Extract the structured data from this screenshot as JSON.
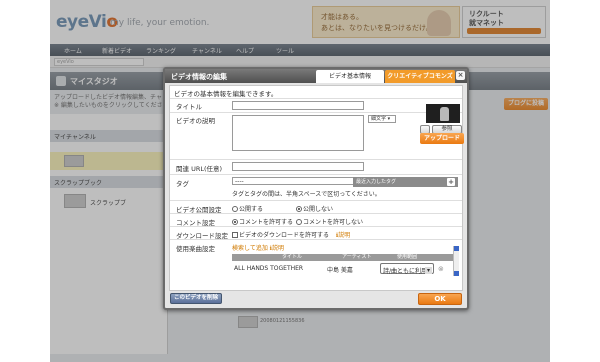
{
  "site": {
    "logo": "eyeVio",
    "logo_accent": "o",
    "tagline": "my life, your emotion.",
    "ad1_text": "才能はある。\nあとは、なりたいを見つけるだけ。",
    "ad2_text": "リクルート\n就マネット",
    "nav": [
      "ホーム",
      "新着ビデオ",
      "ランキング",
      "チャンネル",
      "ヘルプ",
      "ツール"
    ],
    "search_placeholder": "eyeVio",
    "studio_title": "マイスタジオ",
    "info_line": "アップロードしたビデオ情報編集、チャンネル作成",
    "info_line2": "※ 編集したいものをクリックしてください。",
    "left_headers": [
      "マイチャンネル",
      "スクラップブック"
    ],
    "left_item": "スクラップブ",
    "right_btn_1": "ブログに投稿",
    "bottom_code": "20080121155836",
    "colors": {
      "orange": "#ec7f18",
      "nav_dark": "#4b5560",
      "accent_blue": "#6b8fb2"
    }
  },
  "modal": {
    "title": "ビデオ情報の編集",
    "tabs": [
      "ビデオ基本情報",
      "クリエイティブコモンズ"
    ],
    "close": "×",
    "description": "ビデオの基本情報を編集できます。",
    "labels": {
      "title": "タイトル",
      "desc": "ビデオの説明",
      "url": "関連 URL(任意)",
      "tag": "タグ",
      "public": "ビデオ公開設定",
      "comment": "コメント設定",
      "download": "ダウンロード設定",
      "music": "使用楽曲設定"
    },
    "font_select": "細文字",
    "ref_button": "参照",
    "upload_button": "アップロード",
    "tag_value": "----",
    "tag_suggest": "最近入力したタグ",
    "tag_plus": "+",
    "tag_hint": "タグとタグの間は、半角スペースで区切ってください。",
    "public_options": [
      {
        "label": "公開する",
        "checked": false
      },
      {
        "label": "公開しない",
        "checked": true
      }
    ],
    "comment_options": [
      {
        "label": "コメントを許可する",
        "checked": true
      },
      {
        "label": "コメントを許可しない",
        "checked": false
      }
    ],
    "download_label": "ビデオのダウンロードを許可する",
    "download_checked": false,
    "download_link": "説明",
    "music_search": "検索して追加",
    "music_help": "説明",
    "music_columns": [
      "タイトル",
      "アーティスト",
      "使用範囲"
    ],
    "music_rows": [
      {
        "title": "ALL HANDS TOGETHER",
        "artist": "中島 美嘉",
        "scope": "詩/曲ともに利用"
      }
    ],
    "delete_button": "このビデオを削除",
    "ok_button": "OK"
  }
}
